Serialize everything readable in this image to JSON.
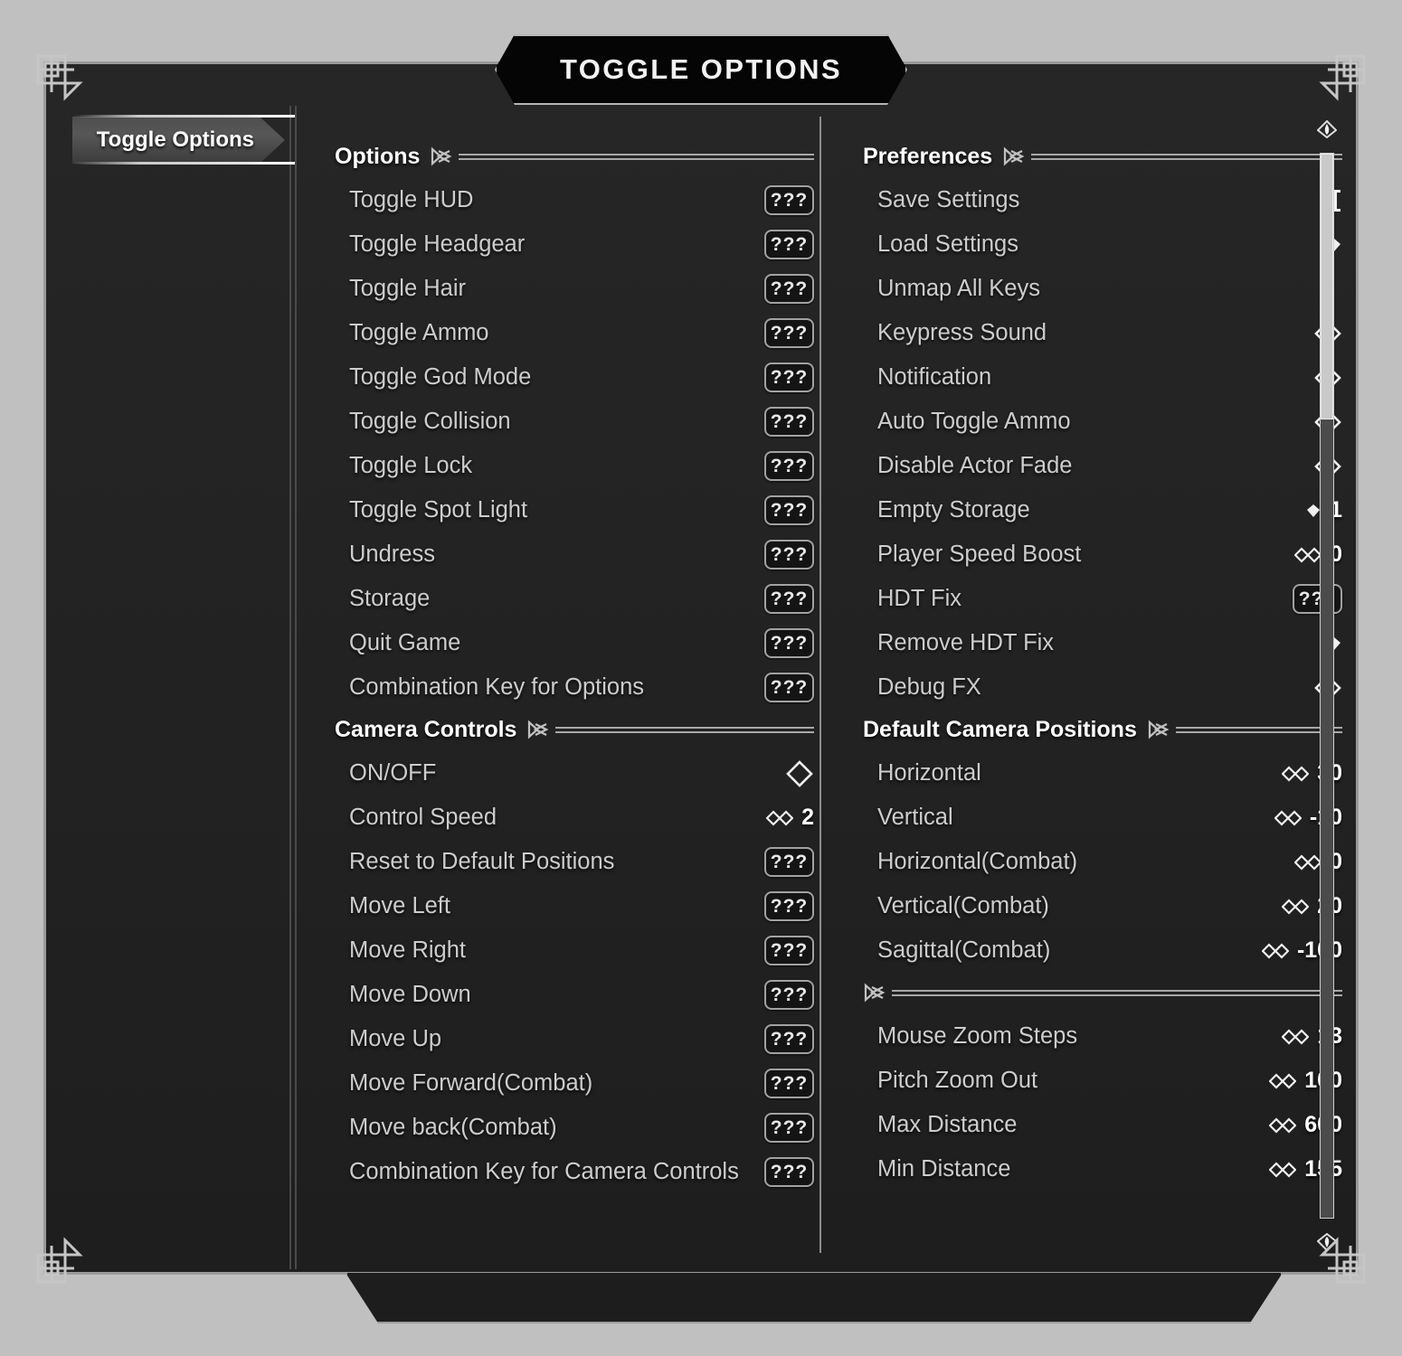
{
  "window": {
    "title": "TOGGLE OPTIONS",
    "accent_color": "#c9c9c9",
    "frame_color": "#9a9a9a",
    "background_color": "#c0c0c0",
    "panel_color": "#242424"
  },
  "sidebar": {
    "items": [
      {
        "label": "Toggle Options",
        "selected": true
      }
    ]
  },
  "scrollbar": {
    "up_arrow_icon": "scroll-up-arrow-icon",
    "down_arrow_icon": "scroll-down-arrow-icon",
    "thumb_position_percent": 0,
    "thumb_size_percent": 25
  },
  "columns": [
    {
      "name": "left",
      "sections": [
        {
          "title": "Options",
          "items": [
            {
              "label": "Toggle HUD",
              "control": "keybind",
              "value": "???"
            },
            {
              "label": "Toggle Headgear",
              "control": "keybind",
              "value": "???"
            },
            {
              "label": "Toggle Hair",
              "control": "keybind",
              "value": "???"
            },
            {
              "label": "Toggle Ammo",
              "control": "keybind",
              "value": "???"
            },
            {
              "label": "Toggle God Mode",
              "control": "keybind",
              "value": "???"
            },
            {
              "label": "Toggle Collision",
              "control": "keybind",
              "value": "???"
            },
            {
              "label": "Toggle Lock",
              "control": "keybind",
              "value": "???"
            },
            {
              "label": "Toggle Spot Light",
              "control": "keybind",
              "value": "???"
            },
            {
              "label": "Undress",
              "control": "keybind",
              "value": "???"
            },
            {
              "label": "Storage",
              "control": "keybind",
              "value": "???"
            },
            {
              "label": "Quit Game",
              "control": "keybind",
              "value": "???"
            },
            {
              "label": "Combination Key for Options",
              "control": "keybind",
              "value": "???"
            }
          ]
        },
        {
          "title": "Camera Controls",
          "items": [
            {
              "label": "ON/OFF",
              "control": "checkbox",
              "value": "",
              "checked": false
            },
            {
              "label": "Control Speed",
              "control": "slider",
              "value": "2"
            },
            {
              "label": "Reset to Default Positions",
              "control": "keybind",
              "value": "???"
            },
            {
              "label": "Move Left",
              "control": "keybind",
              "value": "???"
            },
            {
              "label": "Move Right",
              "control": "keybind",
              "value": "???"
            },
            {
              "label": "Move Down",
              "control": "keybind",
              "value": "???"
            },
            {
              "label": "Move Up",
              "control": "keybind",
              "value": "???"
            },
            {
              "label": "Move Forward(Combat)",
              "control": "keybind",
              "value": "???"
            },
            {
              "label": "Move back(Combat)",
              "control": "keybind",
              "value": "???"
            },
            {
              "label": "Combination Key for Camera Controls",
              "control": "keybind",
              "value": "???"
            }
          ]
        }
      ]
    },
    {
      "name": "right",
      "sections": [
        {
          "title": "Preferences",
          "items": [
            {
              "label": "Save Settings",
              "control": "text-input",
              "value": ""
            },
            {
              "label": "Load Settings",
              "control": "menu",
              "value": ""
            },
            {
              "label": "Unmap All Keys",
              "control": "none",
              "value": ""
            },
            {
              "label": "Keypress Sound",
              "control": "checkbox",
              "value": "",
              "checked": false
            },
            {
              "label": "Notification",
              "control": "checkbox",
              "value": "",
              "checked": false
            },
            {
              "label": "Auto Toggle Ammo",
              "control": "checkbox",
              "value": "",
              "checked": false
            },
            {
              "label": "Disable Actor Fade",
              "control": "checkbox",
              "value": "",
              "checked": false
            },
            {
              "label": "Empty Storage",
              "control": "menu",
              "value": "1"
            },
            {
              "label": "Player Speed Boost",
              "control": "slider",
              "value": "0"
            },
            {
              "label": "HDT Fix",
              "control": "keybind",
              "value": "???"
            },
            {
              "label": "Remove HDT Fix",
              "control": "menu",
              "value": ""
            },
            {
              "label": "Debug FX",
              "control": "checkbox",
              "value": "",
              "checked": false
            }
          ]
        },
        {
          "title": "Default Camera Positions",
          "items": [
            {
              "label": "Horizontal",
              "control": "slider",
              "value": "30"
            },
            {
              "label": "Vertical",
              "control": "slider",
              "value": "-10"
            },
            {
              "label": "Horizontal(Combat)",
              "control": "slider",
              "value": "0"
            },
            {
              "label": "Vertical(Combat)",
              "control": "slider",
              "value": "20"
            },
            {
              "label": "Sagittal(Combat)",
              "control": "slider",
              "value": "-100"
            }
          ]
        },
        {
          "title": "",
          "items": [
            {
              "label": "Mouse Zoom Steps",
              "control": "slider",
              "value": "13"
            },
            {
              "label": "Pitch Zoom Out",
              "control": "slider",
              "value": "100"
            },
            {
              "label": "Max Distance",
              "control": "slider",
              "value": "600"
            },
            {
              "label": "Min Distance",
              "control": "slider",
              "value": "155"
            }
          ]
        }
      ]
    }
  ]
}
